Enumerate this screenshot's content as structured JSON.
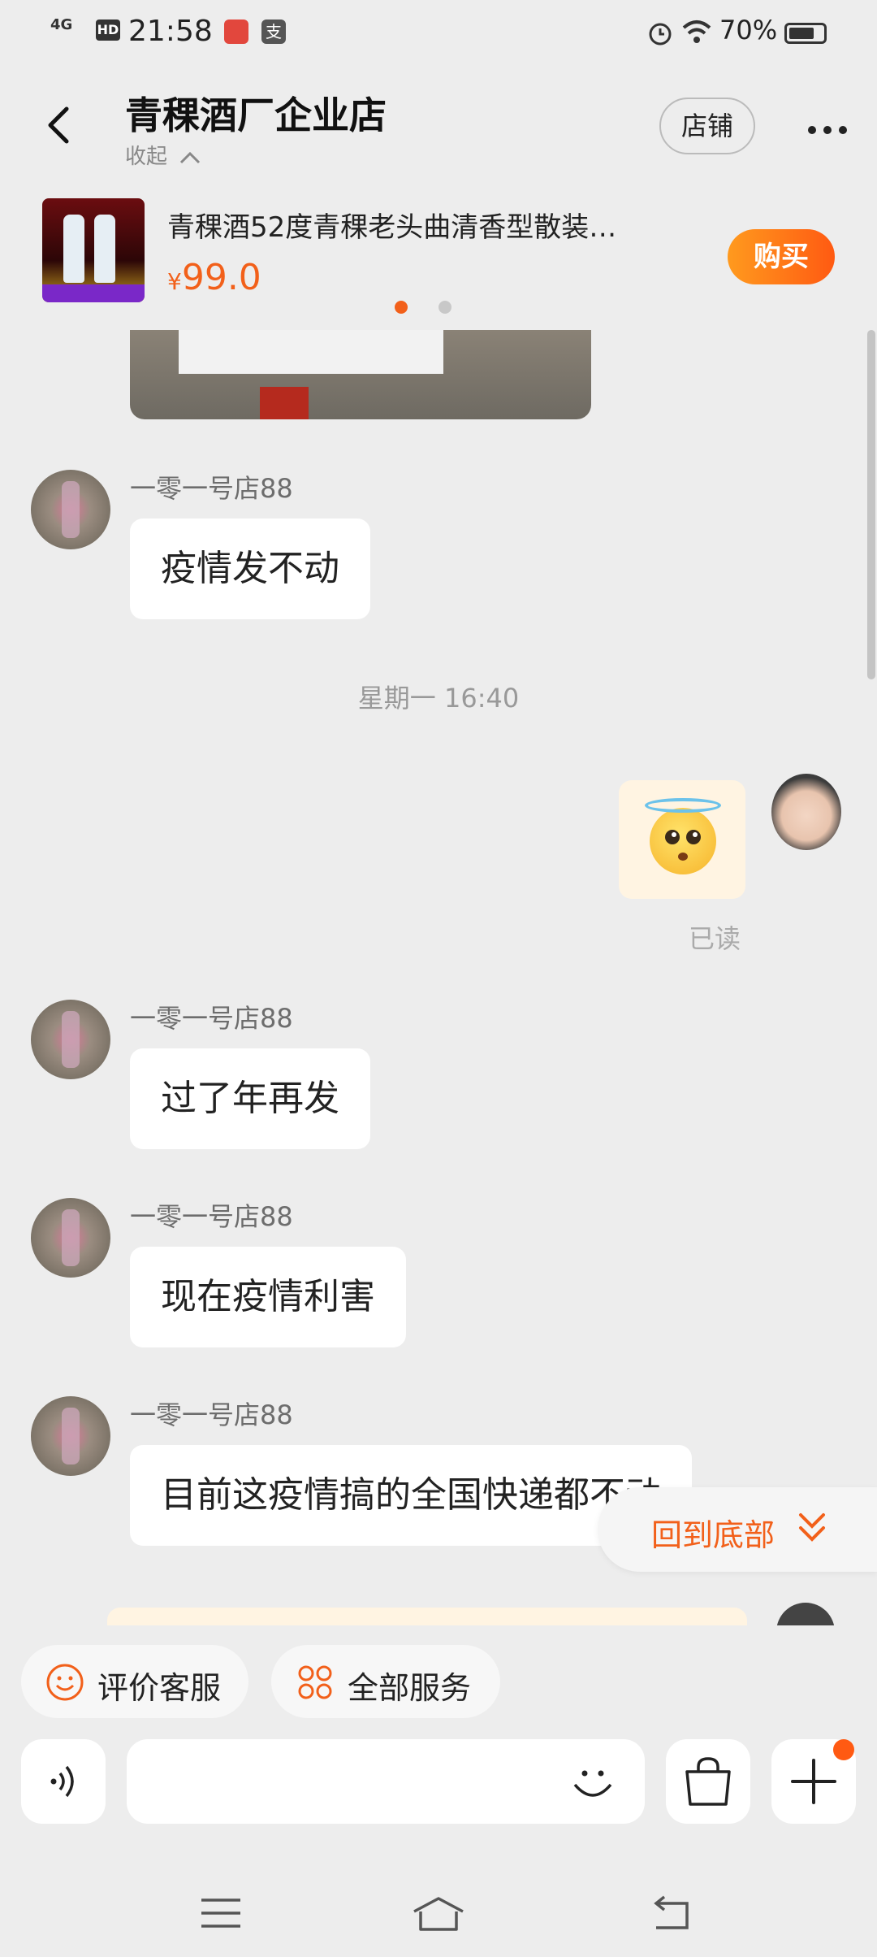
{
  "status_bar": {
    "network": "4G",
    "hd": "HD",
    "time": "21:58",
    "app_icon_2": "支",
    "battery": "70%"
  },
  "header": {
    "shop_name": "青稞酒厂企业店",
    "collapse_label": "收起",
    "store_button": "店铺"
  },
  "product": {
    "title": "青稞酒52度青稞老头曲清香型散装…",
    "price_symbol": "¥",
    "price": "99.0",
    "buy_button": "购买"
  },
  "messages": [
    {
      "sender": "一零一号店88",
      "text": "疫情发不动"
    },
    {
      "timestamp": "星期一 16:40"
    },
    {
      "read_status": "已读"
    },
    {
      "sender": "一零一号店88",
      "text": "过了年再发"
    },
    {
      "sender": "一零一号店88",
      "text": "现在疫情利害"
    },
    {
      "sender": "一零一号店88",
      "text": "目前这疫情搞的全国快递都不动"
    }
  ],
  "back_to_bottom": "回到底部",
  "services": {
    "rate_label": "评价客服",
    "all_label": "全部服务"
  },
  "colors": {
    "accent": "#f2601a",
    "background": "#ededed",
    "bubble": "#ffffff"
  }
}
